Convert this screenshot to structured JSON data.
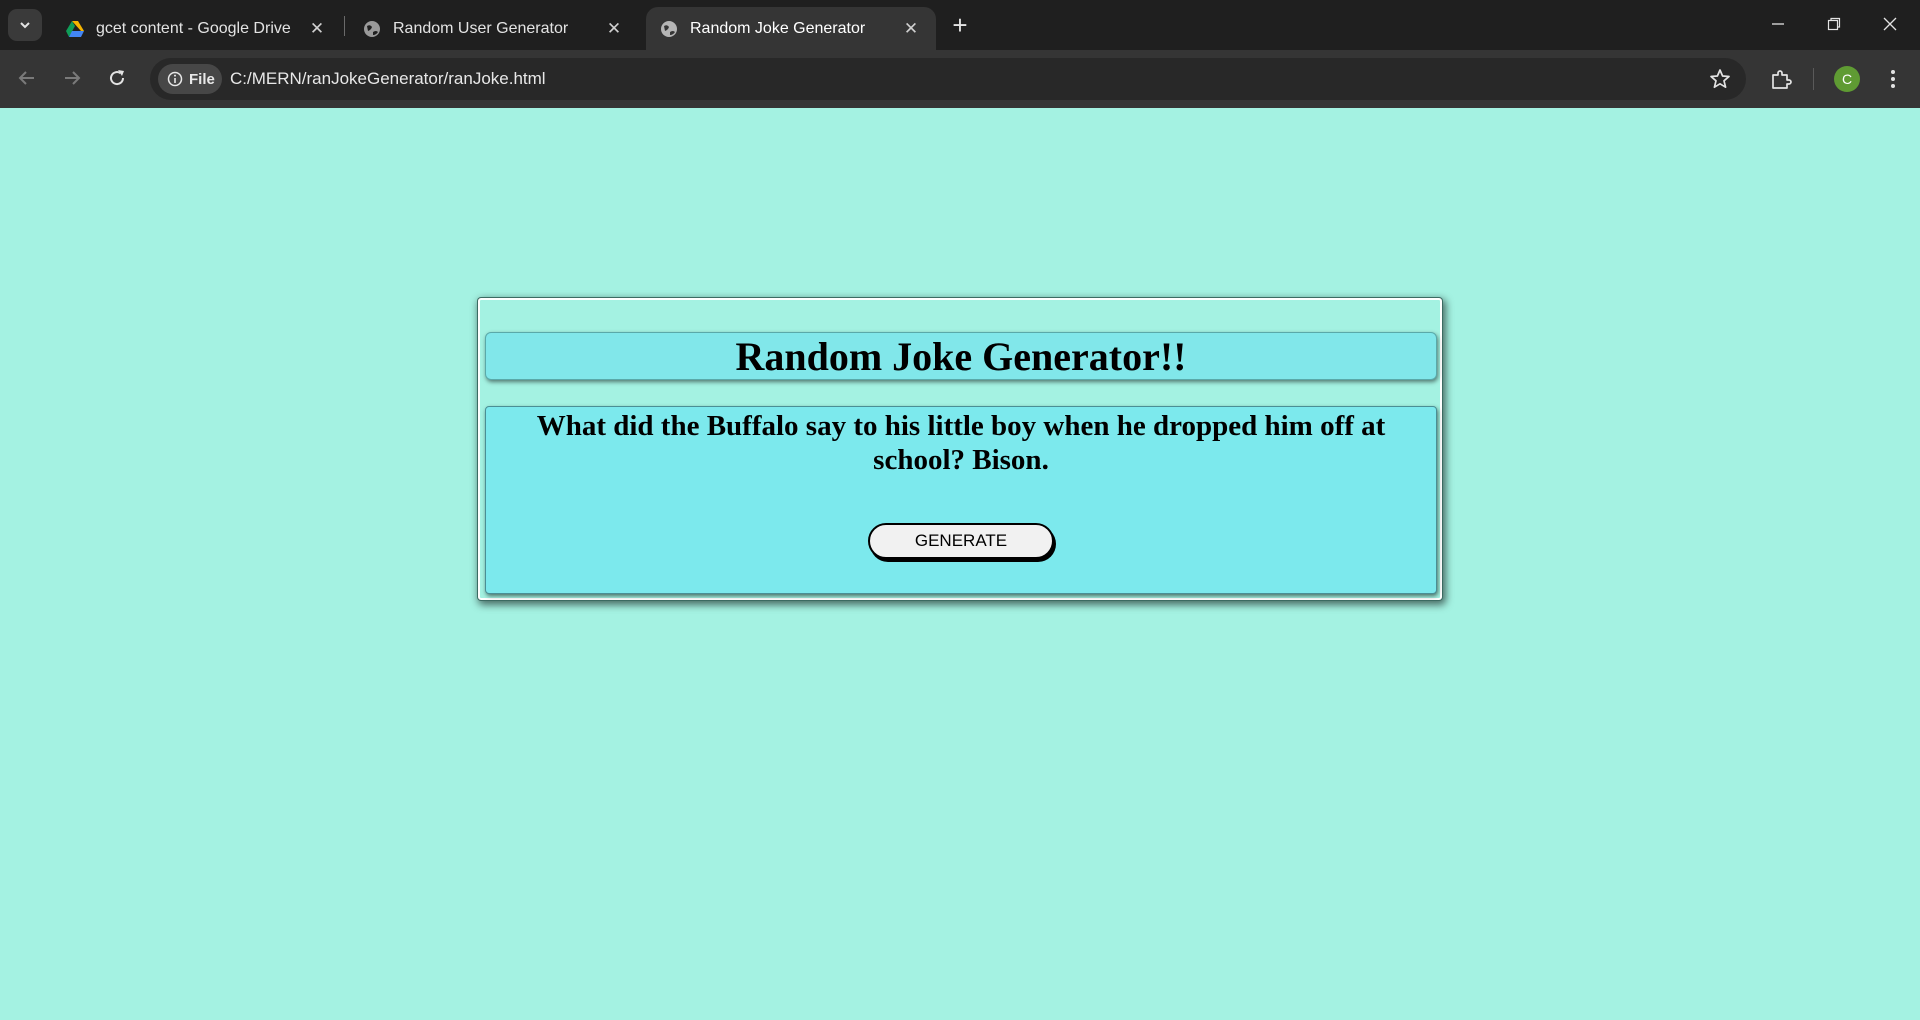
{
  "browser": {
    "tabs": [
      {
        "title": "gcet content - Google Drive",
        "favicon": "google-drive-icon",
        "active": false
      },
      {
        "title": "Random User Generator",
        "favicon": "globe-icon",
        "active": false
      },
      {
        "title": "Random Joke Generator",
        "favicon": "globe-icon",
        "active": true
      }
    ],
    "omnibox": {
      "scheme_chip": "File",
      "url": "C:/MERN/ranJokeGenerator/ranJoke.html"
    },
    "profile_initial": "C"
  },
  "page": {
    "heading": "Random Joke Generator!!",
    "joke": "What did the Buffalo say to his little boy when he dropped him off at school? Bison.",
    "generate_label": "GENERATE"
  },
  "colors": {
    "page_background": "#a4f2e2",
    "heading_background": "#81e7ea",
    "joke_background": "#7ce9ed"
  }
}
